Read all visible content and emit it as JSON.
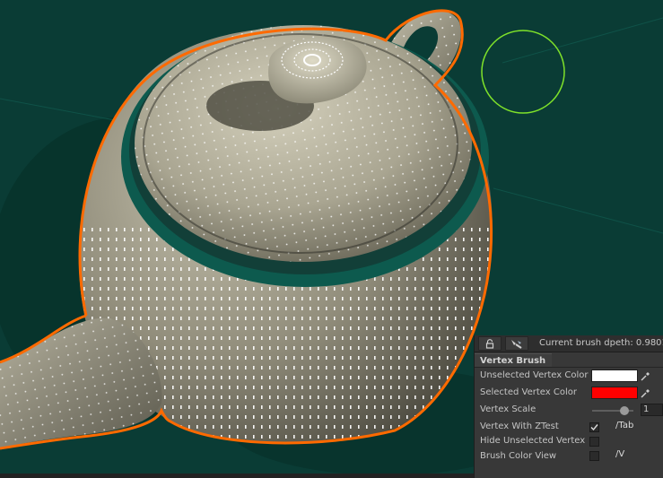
{
  "toolbar": {
    "lock_icon": "lock-icon",
    "brush_icon": "brush-icon",
    "depth_label": "Current brush dpeth: 0.9801"
  },
  "tab": {
    "label": "Vertex Brush"
  },
  "rows": {
    "unselected_color": {
      "label": "Unselected Vertex Color",
      "color": "#ffffff"
    },
    "selected_color": {
      "label": "Selected Vertex Color",
      "color": "#ff0000"
    },
    "vertex_scale": {
      "label": "Vertex Scale",
      "value": "1",
      "slider_fraction": 0.85
    },
    "ztest": {
      "label": "Vertex With ZTest",
      "checked": true,
      "shortcut": "/Tab"
    },
    "hide_unselected": {
      "label": "Hide Unselected Vertex",
      "checked": false
    },
    "brush_color_view": {
      "label": "Brush Color View",
      "checked": false,
      "shortcut": "/V"
    }
  },
  "colors": {
    "background": "#0a3a33",
    "outline": "#ff6a00",
    "brush_circle": "#7fe22a",
    "vertex_dots": "#ffffff",
    "model": "#9c9886"
  }
}
